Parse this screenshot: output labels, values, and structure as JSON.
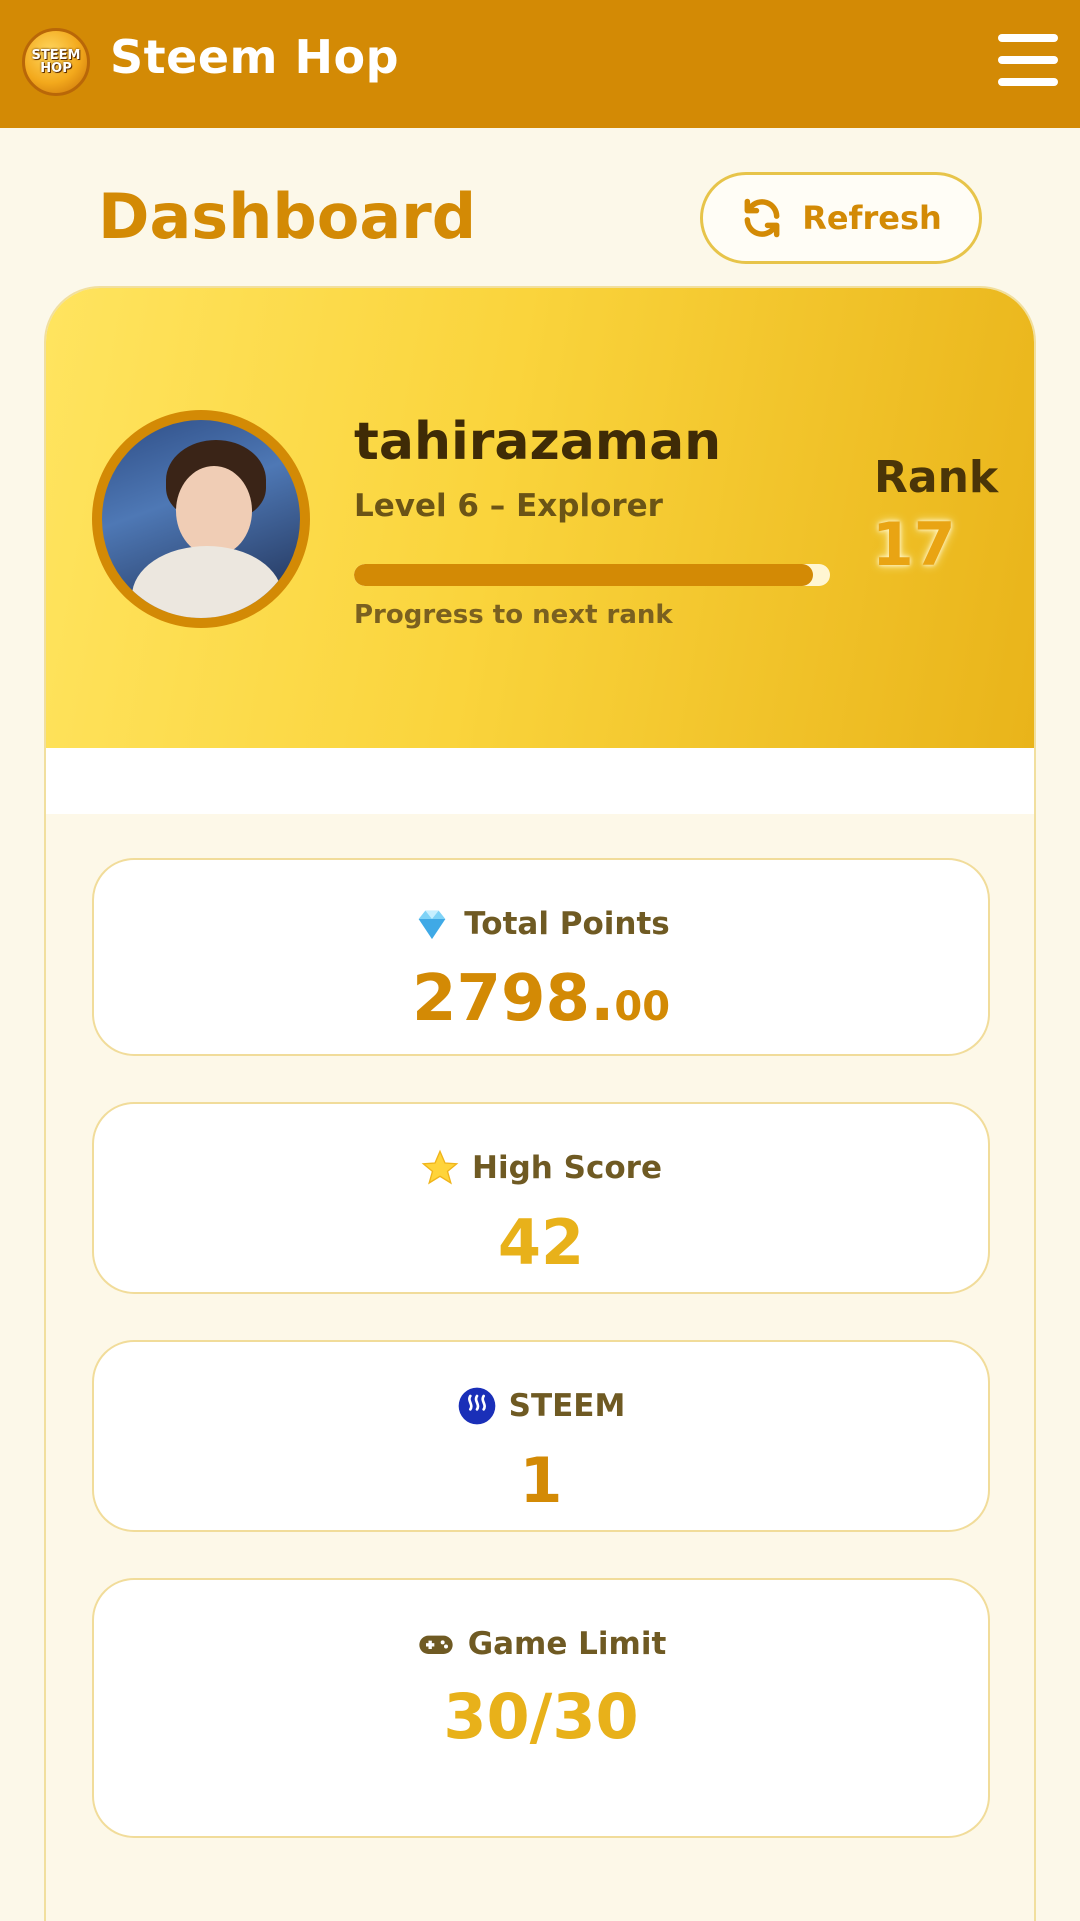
{
  "header": {
    "app_title": "Steem Hop",
    "logo_text": "STEEM HOP",
    "menu_icon": "hamburger-menu-icon"
  },
  "page": {
    "title": "Dashboard",
    "refresh_label": "Refresh"
  },
  "profile": {
    "username": "tahirazaman",
    "level": "Level 6 – Explorer",
    "progress_fraction": 0.965,
    "progress_label": "Progress to next rank",
    "rank_label": "Rank",
    "rank_value": "17"
  },
  "stats": {
    "total_points": {
      "title": "Total Points",
      "value_int": "2798.",
      "value_dec": "00",
      "icon": "diamond-icon"
    },
    "high_score": {
      "title": "High Score",
      "value": "42",
      "icon": "star-icon"
    },
    "steem": {
      "title": "STEEM",
      "value": "1",
      "icon": "steem-logo-icon"
    },
    "game_limit": {
      "title": "Game Limit",
      "value": "30/30",
      "icon": "gamepad-icon"
    }
  },
  "colors": {
    "header_bg": "#d38a05",
    "accent": "#d38a05",
    "page_bg": "#fcf8e9",
    "highlight_value": "#e8b11a"
  }
}
